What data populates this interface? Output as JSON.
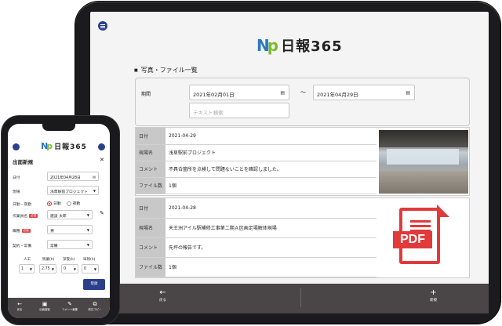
{
  "tablet": {
    "logo_mark_n": "N",
    "logo_mark_p": "p",
    "logo_text": "日報365",
    "section_title": "写真・ファイル一覧",
    "filter": {
      "period_label": "期間",
      "date_from": "2021年02月01日",
      "date_to": "2021年04月29日",
      "tilde": "～",
      "text_placeholder": "テキスト検索"
    },
    "records": [
      {
        "rows": [
          {
            "key": "日付",
            "value": "2021-04-29"
          },
          {
            "key": "現場名",
            "value": "浅草駅前プロジェクト"
          },
          {
            "key": "コメント",
            "value": "不具合箇所を点検して問題ないことを確認しました。"
          },
          {
            "key": "ファイル数",
            "value": "1個"
          }
        ],
        "attachment": "photo"
      },
      {
        "rows": [
          {
            "key": "日付",
            "value": "2021-04-28"
          },
          {
            "key": "現場名",
            "value": "天王洲アイル駅補修工事第二期Ａ区画足場解体現場"
          },
          {
            "key": "コメント",
            "value": "先坪の報告です。"
          },
          {
            "key": "ファイル数",
            "value": "1個"
          }
        ],
        "attachment": "pdf",
        "pdf_label": "PDF"
      }
    ],
    "footer": {
      "back_icon": "←",
      "back_label": "戻る",
      "new_icon": "+",
      "new_label": "新規"
    }
  },
  "phone": {
    "logo_text": "日報365",
    "title": "出面新規",
    "close": "✕",
    "fields": {
      "date_label": "日付",
      "date_value": "2021年04月28日",
      "site_label": "現場",
      "site_value": "浅草駅前プロジェクト",
      "shift_label": "日勤・夜勤",
      "shift_day": "日勤",
      "shift_night": "夜勤",
      "worker_label": "作業員名",
      "worker_value": "建設 太郎",
      "job_label": "職種",
      "job_value": "鳶",
      "contract_label": "契約・常備",
      "contract_value": "常備",
      "required_badge": "必須"
    },
    "hours": {
      "headers": [
        "人工",
        "残業(h)",
        "深夜(h)",
        "早残(h)"
      ],
      "values": [
        "1",
        "2.75",
        "0",
        "0"
      ]
    },
    "submit_label": "登録",
    "footer": [
      {
        "icon": "←",
        "label": "戻る"
      },
      {
        "icon": "▣",
        "label": "出面複製"
      },
      {
        "icon": "✎",
        "label": "コメント編集"
      },
      {
        "icon": "⧉",
        "label": "前日コピー"
      }
    ]
  }
}
